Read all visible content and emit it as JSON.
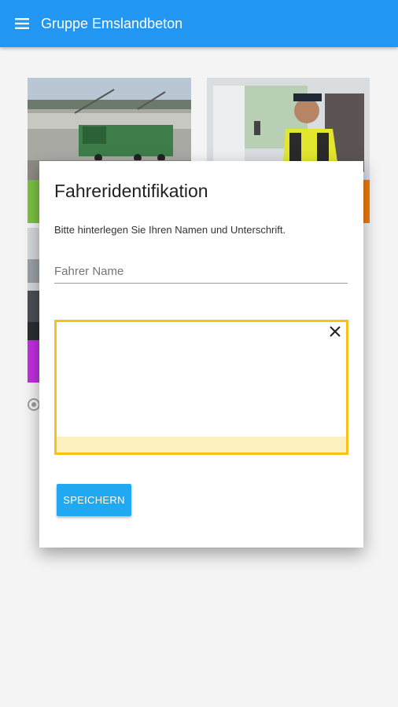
{
  "app_bar": {
    "title": "Gruppe Emslandbeton",
    "menu_icon": "menu-icon",
    "color": "#2196f3"
  },
  "tiles": [
    {
      "photo": "construction-site-photo",
      "strip_color": "#7cc242"
    },
    {
      "photo": "truck-driver-photo",
      "strip_color": "#f07c0c"
    },
    {
      "photo": "truck-photo",
      "strip_color": "#c02fe0"
    }
  ],
  "dialog": {
    "title": "Fahreridentifikation",
    "instructions": "Bitte hinterlegen Sie Ihren Namen und Unterschrift.",
    "name_placeholder": "Fahrer Name",
    "name_value": "",
    "signature_border_color": "#f5c317",
    "clear_icon": "close-icon",
    "save_label": "SPEICHERN",
    "save_color": "#20a8f0"
  }
}
